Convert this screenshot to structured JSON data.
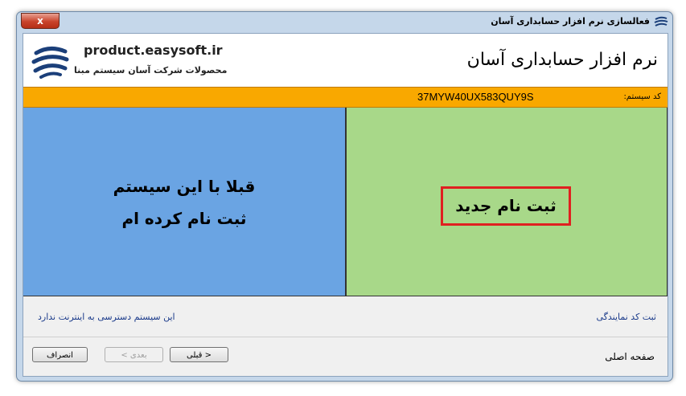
{
  "window": {
    "title": "فعالسازی نرم افزار حسابداری آسان",
    "close_glyph": "x"
  },
  "header": {
    "product_title": "نرم افزار حسابداری آسان",
    "website": "product.easysoft.ir",
    "company": "محصولات شرکت آسان سیستم مبنا"
  },
  "system_code": {
    "label": "کد سیستم:",
    "value": "37MYW40UX583QUY9S"
  },
  "options": {
    "already_registered_line1": "قبلا با این سیستم",
    "already_registered_line2": "ثبت نام کرده ام",
    "new_registration": "ثبت نام جدید"
  },
  "links": {
    "no_internet": "این سیستم دسترسی به اینترنت ندارد",
    "agent_code": "ثبت کد نمایندگی"
  },
  "footer": {
    "cancel_label": "انصراف",
    "next_label": "بعدی >",
    "back_label": "< قبلی",
    "home_label": "صفحه اصلی"
  },
  "colors": {
    "code_bar": "#f9a800",
    "already_registered_panel": "#6aa4e3",
    "new_registration_panel": "#a8d889",
    "highlight_border": "#e02020"
  },
  "icons": {
    "app": "easysoft-logo-icon",
    "close": "close-icon"
  }
}
